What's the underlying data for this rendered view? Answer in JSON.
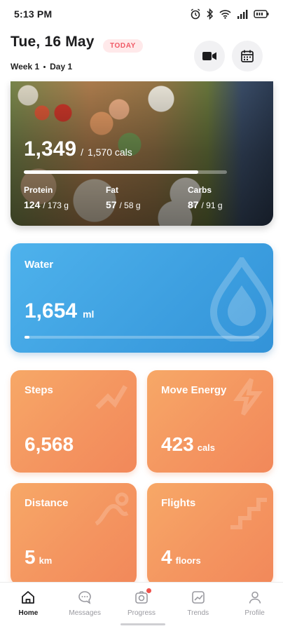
{
  "status_bar": {
    "time": "5:13 PM"
  },
  "header": {
    "date": "Tue, 16 May",
    "badge": "TODAY",
    "week": "Week 1",
    "day": "Day 1"
  },
  "nutrition": {
    "calories": "1,349",
    "calories_goal": "1,570 cals",
    "calories_progress": 0.86,
    "protein": {
      "label": "Protein",
      "value": "124",
      "goal": "173 g"
    },
    "fat": {
      "label": "Fat",
      "value": "57",
      "goal": "58 g"
    },
    "carbs": {
      "label": "Carbs",
      "value": "87",
      "goal": "91 g"
    }
  },
  "water": {
    "label": "Water",
    "value": "1,654",
    "unit": "ml",
    "progress": 0.02
  },
  "tiles": {
    "steps": {
      "label": "Steps",
      "value": "6,568",
      "unit": ""
    },
    "move_energy": {
      "label": "Move Energy",
      "value": "423",
      "unit": "cals"
    },
    "distance": {
      "label": "Distance",
      "value": "5",
      "unit": "km"
    },
    "flights": {
      "label": "Flights",
      "value": "4",
      "unit": "floors"
    }
  },
  "tab_bar": {
    "home": "Home",
    "messages": "Messages",
    "progress": "Progress",
    "trends": "Trends",
    "profile": "Profile",
    "active": "home"
  },
  "colors": {
    "accent_water": "#3d9fe0",
    "accent_tile": "#f49560",
    "badge_text": "#f05a66",
    "notification_dot": "#f0504a"
  }
}
